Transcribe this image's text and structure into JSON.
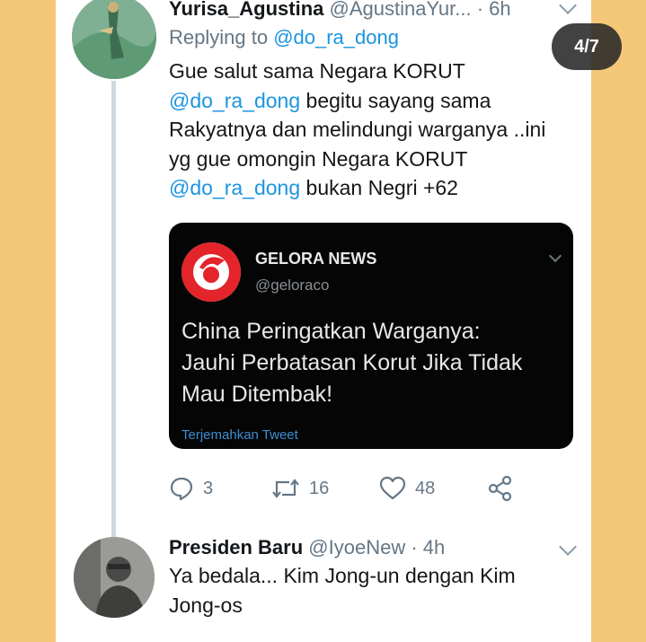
{
  "tweet1": {
    "name": "Yurisa_Agustina",
    "handle": "@AgustinaYur...",
    "time": "· 6h",
    "replying_prefix": "Replying to ",
    "replying_handle": "@do_ra_dong",
    "line1": "Gue salut sama Negara KORUT",
    "mention1": "@do_ra_dong",
    "line2_rest": " begitu sayang sama",
    "line3": "Rakyatnya dan melindungi warganya ..ini",
    "line4": "yg gue omongin Negara KORUT",
    "mention2": "@do_ra_dong",
    "line5_rest": " bukan Negri +62",
    "quote": {
      "name": "GELORA NEWS",
      "handle": "@geloraco",
      "text_line1": "China Peringatkan Warganya:",
      "text_line2": "Jauhi Perbatasan Korut Jika Tidak",
      "text_line3": "Mau Ditembak!",
      "translate": "Terjemahkan Tweet"
    },
    "actions": {
      "replies": "3",
      "retweets": "16",
      "likes": "48"
    }
  },
  "tweet2": {
    "name": "Presiden Baru",
    "handle": "@IyoeNew",
    "time": "· 4h",
    "line1": "Ya bedala... Kim Jong-un dengan Kim",
    "line2": "Jong-os"
  },
  "pager": "4/7",
  "icons": [
    "reply-icon",
    "retweet-icon",
    "like-icon",
    "share-icon",
    "chevron-down-icon"
  ],
  "colors": {
    "background": "#f5c778",
    "link": "#1b95e0",
    "quote_bg": "#050505",
    "logo_red": "#e3242b"
  }
}
